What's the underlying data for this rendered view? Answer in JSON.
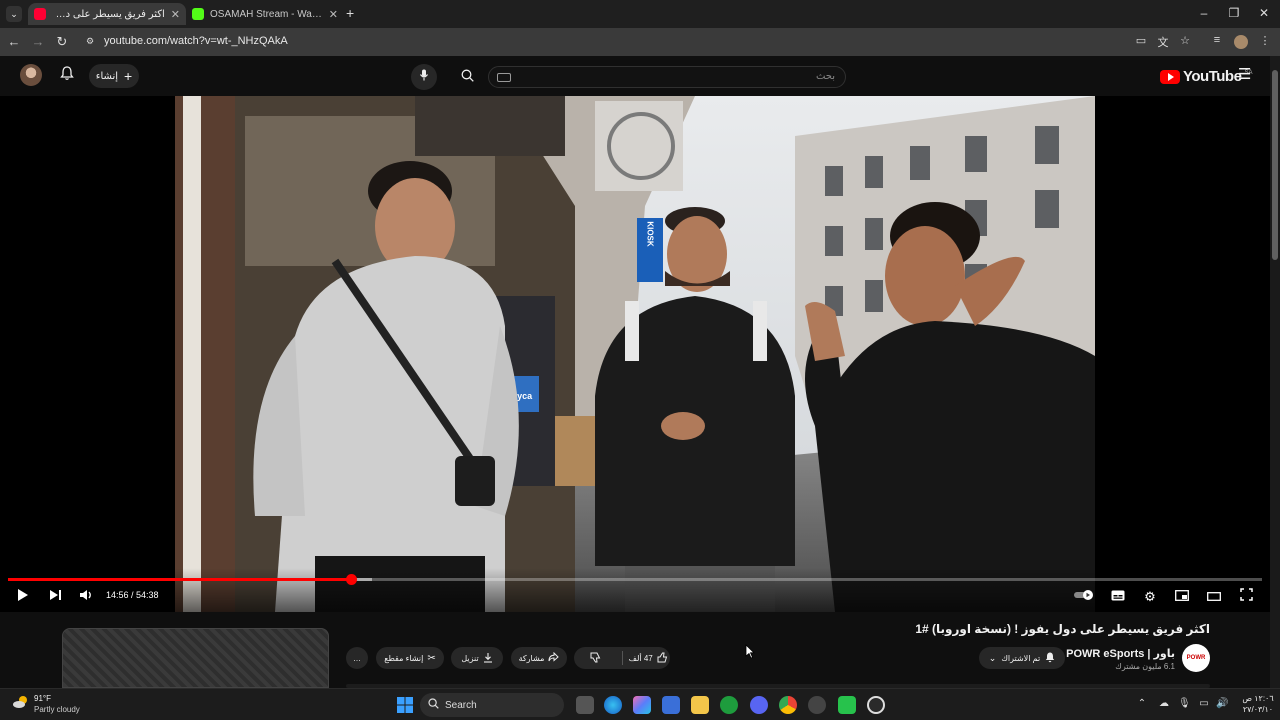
{
  "browser": {
    "tabs": [
      {
        "title": "اكثر فريق يسيطر على دول يفوز",
        "active": true,
        "favicon_color": "#ff0033"
      },
      {
        "title": "OSAMAH Stream - Watch Live on",
        "active": false,
        "favicon_color": "#53fc18"
      }
    ],
    "url": "youtube.com/watch?v=wt-_NHzQAkA"
  },
  "youtube": {
    "create_label": "إنشاء",
    "search_placeholder": "بحث",
    "logo_text": "YouTube",
    "region": "SA"
  },
  "player": {
    "time_current": "14:56",
    "time_total": "54:38",
    "time_display": "14:56 / 54:38",
    "progress_fraction": 0.2733,
    "buffered_fraction": 0.29,
    "scene_signs": {
      "kiosk": "KIOSK",
      "shop": "Lyca"
    }
  },
  "video": {
    "title": "اكثر فريق يسيطر على دول يفوز ! (نسخة اوروبا) #1",
    "channel": "POWR eSports | باور",
    "subscribers": "6.1 مليون مشترك",
    "subscribe_label": "تم الاشتراك",
    "likes": "47 ألف",
    "share_label": "مشاركة",
    "download_label": "تنزيل",
    "clip_label": "إنشاء مقطع",
    "more_label": "…",
    "channel_avatar_text": "POWR"
  },
  "taskbar": {
    "weather_temp": "91°F",
    "weather_desc": "Partly cloudy",
    "search_label": "Search",
    "time": "١٢:٠٦ ص",
    "date": "٢٧/٠٣/١٠"
  },
  "colors": {
    "accent": "#ff0000",
    "background": "#0f0f0f",
    "pill": "#272727"
  }
}
